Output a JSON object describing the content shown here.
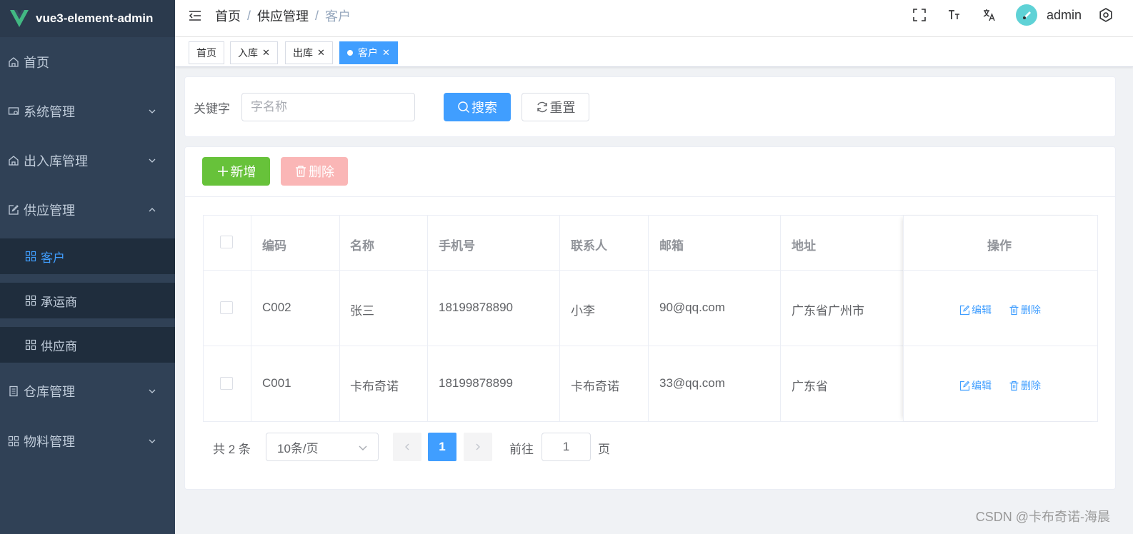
{
  "app": {
    "title": "vue3-element-admin"
  },
  "sidebar": {
    "items": [
      {
        "label": "首页",
        "icon": "home-icon"
      },
      {
        "label": "系统管理",
        "icon": "system-icon"
      },
      {
        "label": "出入库管理",
        "icon": "home-icon"
      },
      {
        "label": "供应管理",
        "icon": "edit-icon"
      },
      {
        "label": "仓库管理",
        "icon": "document-icon"
      },
      {
        "label": "物料管理",
        "icon": "grid-icon"
      }
    ],
    "sub_items": [
      {
        "label": "客户",
        "icon": "grid-icon",
        "active": true
      },
      {
        "label": "承运商",
        "icon": "grid-icon"
      },
      {
        "label": "供应商",
        "icon": "grid-icon"
      }
    ]
  },
  "header": {
    "breadcrumb": [
      "首页",
      "供应管理",
      "客户"
    ],
    "separator": "/",
    "username": "admin"
  },
  "tags": [
    {
      "label": "首页"
    },
    {
      "label": "入库"
    },
    {
      "label": "出库"
    },
    {
      "label": "客户",
      "active": true
    }
  ],
  "search": {
    "label": "关键字",
    "placeholder": "字名称",
    "search_label": "搜索",
    "reset_label": "重置"
  },
  "toolbar": {
    "add_label": "新增",
    "delete_label": "删除"
  },
  "table": {
    "columns": [
      "编码",
      "名称",
      "手机号",
      "联系人",
      "邮箱",
      "地址",
      "操作"
    ],
    "rows": [
      {
        "code": "C002",
        "name": "张三",
        "phone": "18199878890",
        "contact": "小李",
        "email": "90@qq.com",
        "address": "广东省广州市"
      },
      {
        "code": "C001",
        "name": "卡布奇诺",
        "phone": "18199878899",
        "contact": "卡布奇诺",
        "email": "33@qq.com",
        "address": "广东省"
      }
    ],
    "edit_label": "编辑",
    "delete_label": "删除"
  },
  "pagination": {
    "total_text": "共 2 条",
    "page_size": "10条/页",
    "current_page": "1",
    "goto_prefix": "前往",
    "goto_value": "1",
    "goto_suffix": "页"
  },
  "watermark": "CSDN @卡布奇诺-海晨",
  "colors": {
    "primary": "#409eff",
    "success": "#67c23a",
    "danger_light": "#fab6b6",
    "sidebar_bg": "#304156"
  }
}
